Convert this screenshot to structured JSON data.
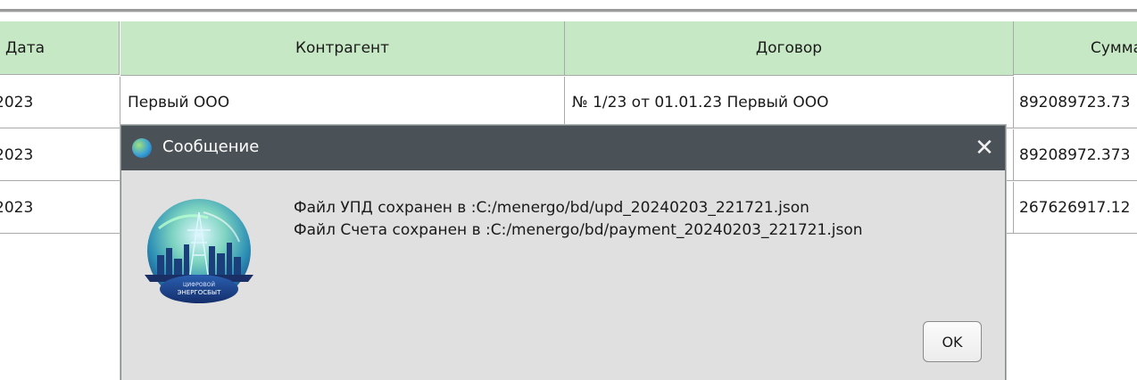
{
  "table": {
    "columns": [
      "Дата",
      "Контрагент",
      "Договор",
      "Сумма"
    ],
    "rows": [
      {
        "date": "2023",
        "counterparty": "Первый ООО",
        "contract": "№ 1/23 от 01.01.23 Первый ООО",
        "sum": "892089723.73"
      },
      {
        "date": "2023",
        "counterparty": "",
        "contract": "",
        "sum": "89208972.373"
      },
      {
        "date": "2023",
        "counterparty": "",
        "contract": "",
        "sum": "267626917.12"
      }
    ]
  },
  "dialog": {
    "title": "Сообщение",
    "close_icon": "close-icon",
    "app_icon": "globe-app-icon",
    "logo_text_line1": "ЦИФРОВОЙ",
    "logo_text_line2": "ЭНЕРГОСБЫТ",
    "message_line1": "Файл УПД сохранен в :C:/menergo/bd/upd_20240203_221721.json",
    "message_line2": "Файл Счета сохранен в :C:/menergo/bd/payment_20240203_221721.json",
    "ok_label": "OK"
  },
  "colors": {
    "header_bg": "#c7e8c5",
    "titlebar_bg": "#4a5157",
    "dialog_bg": "#e0e0e0"
  }
}
